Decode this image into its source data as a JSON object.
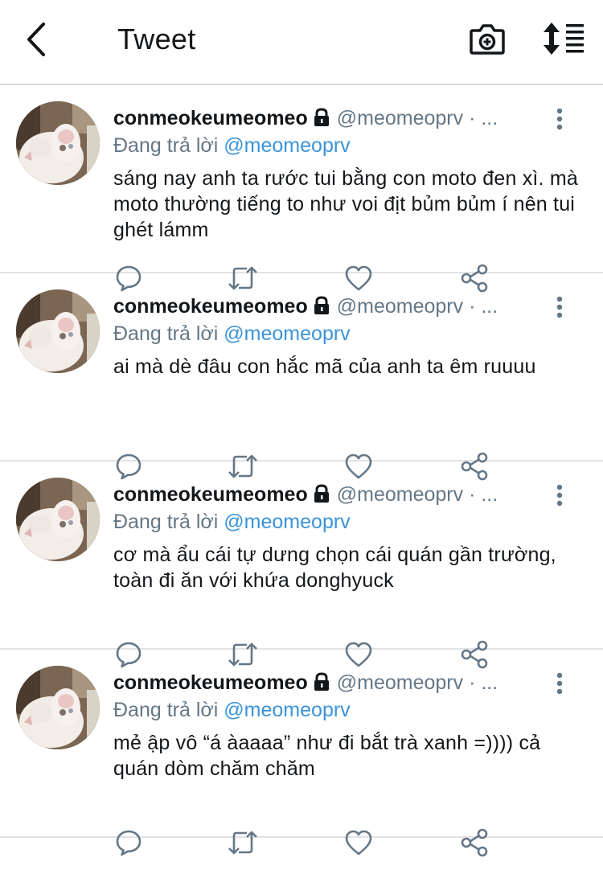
{
  "header": {
    "title": "Tweet",
    "back_icon": "chevron-left-icon",
    "camera_icon": "camera-plus-icon",
    "sort_icon": "sort-list-icon"
  },
  "colors": {
    "link": "#3b94d9",
    "muted": "#657786",
    "text": "#14171a"
  },
  "tweets": [
    {
      "name": "conmeokeumeomeo",
      "handle": "@meomeoprv",
      "dot": "· ...",
      "replying_label": "Đang trả lời",
      "replying_to": "@meomeoprv",
      "text": "sáng nay anh ta rước tui bằng con moto đen xì. mà moto thường tiếng to như voi địt bủm bủm í nên tui ghét lámm"
    },
    {
      "name": "conmeokeumeomeo",
      "handle": "@meomeoprv",
      "dot": "· ...",
      "replying_label": "Đang trả lời",
      "replying_to": "@meomeoprv",
      "text": "ai mà dè đâu con hắc mã của anh ta êm ruuuu"
    },
    {
      "name": "conmeokeumeomeo",
      "handle": "@meomeoprv",
      "dot": "· ...",
      "replying_label": "Đang trả lời",
      "replying_to": "@meomeoprv",
      "text": "cơ mà ẩu cái tự dưng chọn cái quán gần trường, toàn đi ăn với khứa donghyuck"
    },
    {
      "name": "conmeokeumeomeo",
      "handle": "@meomeoprv",
      "dot": "· ...",
      "replying_label": "Đang trả lời",
      "replying_to": "@meomeoprv",
      "text": "mẻ ập vô “á àaaaa” như đi bắt trà xanh =)))) cả quán dòm chăm chăm"
    }
  ]
}
